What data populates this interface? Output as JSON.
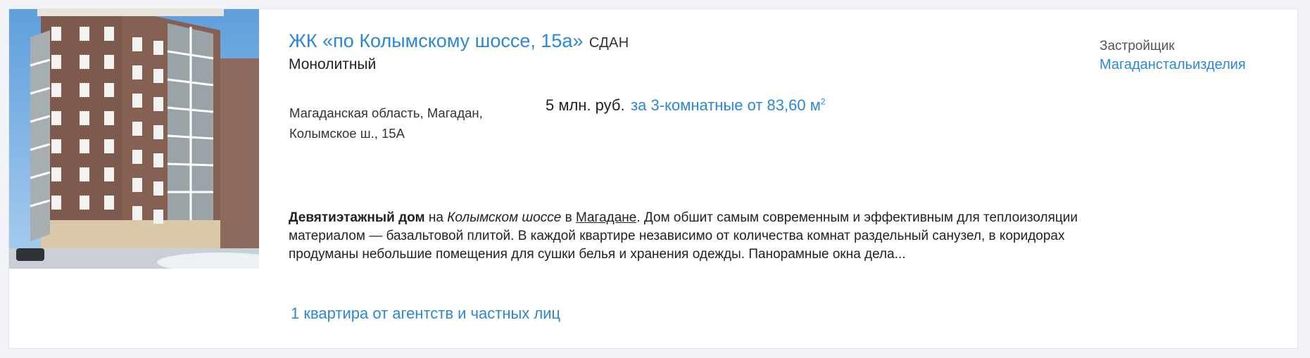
{
  "complex": {
    "title": "ЖК «по Колымскому шоссе, 15а»",
    "status": "СДАН",
    "building_type": "Монолитный",
    "address_line1": "Магаданская область, Магадан,",
    "address_line2": "Колымское ш., 15А"
  },
  "price": {
    "amount": "5 млн. руб.",
    "offer": "за 3-комнатные от 83,60 м",
    "unit_sup": "2"
  },
  "developer": {
    "label": "Застройщик",
    "name": "Магаданстальизделия"
  },
  "description": {
    "bold_lead": "Девятиэтажный дом",
    "text_1": " на ",
    "italic_place": "Колымском шоссе",
    "text_2": " в ",
    "city_link": "Магадане",
    "text_3": ". Дом обшит самым современным и эффективным для теплоизоляции материалом — базальтовой плитой. В каждой квартире независимо от количества комнат раздельный санузел, в коридорах продуманы небольшие помещения для сушки белья и хранения одежды. Панорамные окна дела..."
  },
  "offers": {
    "link": "1 квартира от агентств и частных лиц"
  },
  "colors": {
    "accent": "#2b87da",
    "background": "#f1f3f6",
    "card": "#ffffff"
  }
}
